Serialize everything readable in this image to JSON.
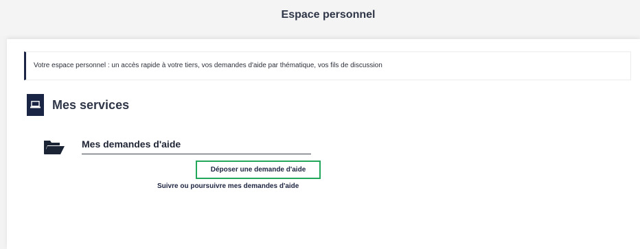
{
  "header": {
    "title": "Espace personnel"
  },
  "info": {
    "text": "Votre espace personnel : un accès rapide à votre tiers, vos demandes d'aide par thématique, vos fils de discussion"
  },
  "services": {
    "title": "Mes services",
    "icon": "laptop-icon"
  },
  "demandes": {
    "title": "Mes demandes d'aide",
    "icon": "folder-open-icon",
    "links": {
      "deposer": "Déposer une demande d'aide",
      "suivre": "Suivre ou poursuivre mes demandes d'aide"
    }
  },
  "colors": {
    "navy": "#1a2445",
    "highlight_border": "#22a65a"
  }
}
